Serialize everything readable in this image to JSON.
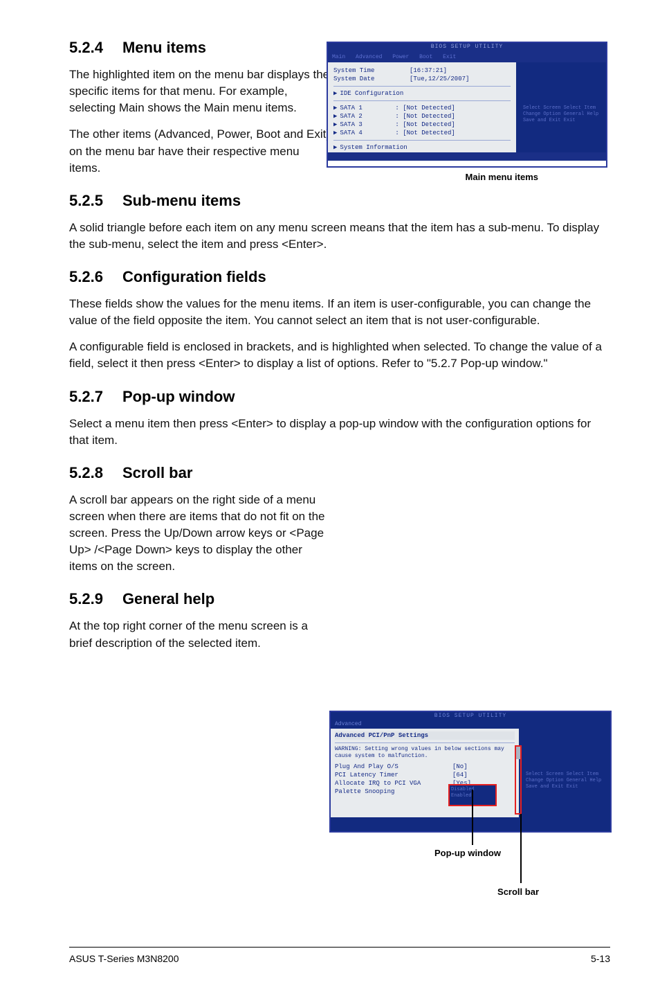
{
  "sections": {
    "s524": {
      "num": "5.2.4",
      "title": "Menu items"
    },
    "s525": {
      "num": "5.2.5",
      "title": "Sub-menu items"
    },
    "s526": {
      "num": "5.2.6",
      "title": "Configuration fields"
    },
    "s527": {
      "num": "5.2.7",
      "title": "Pop-up window"
    },
    "s528": {
      "num": "5.2.8",
      "title": "Scroll bar"
    },
    "s529": {
      "num": "5.2.9",
      "title": "General help"
    }
  },
  "paragraphs": {
    "p524a": "The highlighted item on the menu bar  displays the specific items for that menu. For example, selecting Main shows the Main menu items.",
    "p524b": "The other items (Advanced, Power, Boot and Exit) on the menu bar have their respective menu items.",
    "p525": "A solid triangle before each item on any menu screen means that the item has a sub-menu. To display the sub-menu, select the item and press <Enter>.",
    "p526a": "These fields show the values for the menu items. If an item is user-configurable, you can change the value of the field opposite the item. You cannot select an item that is not user-configurable.",
    "p526b": "A configurable field is enclosed in brackets, and is highlighted when selected. To change the value of a field, select it then press <Enter> to display a list of options. Refer to \"5.2.7 Pop-up window.\"",
    "p527": "Select a menu item then press <Enter> to display a pop-up window with the configuration options for that item.",
    "p528": "A scroll bar appears on the right side of a menu screen when there are items that do not fit on the screen. Press the Up/Down arrow keys or <Page Up> /<Page Down> keys to display the other items on the screen.",
    "p529": "At the top right corner of the menu screen is a brief description of the selected item."
  },
  "bios1": {
    "top": "BIOS SETUP UTILITY",
    "menubar": {
      "a": "Main",
      "b": "Advanced",
      "c": "Power",
      "d": "Boot",
      "e": "Exit"
    },
    "rows": {
      "time_k": "System Time",
      "time_v": "[16:37:21]",
      "date_k": "System Date",
      "date_v": "[Tue,12/25/2007]",
      "ide": "IDE Configuration",
      "s1k": "SATA 1",
      "s1v": ": [Not Detected]",
      "s2k": "SATA 2",
      "s2v": ": [Not Detected]",
      "s3k": "SATA 3",
      "s3v": ": [Not Detected]",
      "s4k": "SATA 4",
      "s4v": ": [Not Detected]",
      "info": "System Information"
    },
    "hints": "Select Screen\nSelect Item\nChange Option\nGeneral Help\nSave and Exit\nExit",
    "caption": "Main menu items"
  },
  "bios2": {
    "top": "BIOS SETUP UTILITY",
    "menubar": "Advanced",
    "title": "Advanced PCI/PnP Settings",
    "warn": "WARNING: Setting wrong values in below sections may cause system to malfunction.",
    "r1k": "Plug And Play O/S",
    "r1v": "[No]",
    "r2k": "PCI Latency Timer",
    "r2v": "[64]",
    "r3k": "Allocate IRQ to PCI VGA",
    "r3v": "[Yes]",
    "r4k": "Palette Snooping",
    "opt1": "Disabled",
    "opt2": "Enabled",
    "hints": "Select Screen\nSelect Item\nChange Option\nGeneral Help\nSave and Exit\nExit",
    "popup_label": "Pop-up window",
    "scroll_label": "Scroll bar"
  },
  "footer": {
    "left": "ASUS T-Series M3N8200",
    "right": "5-13"
  }
}
